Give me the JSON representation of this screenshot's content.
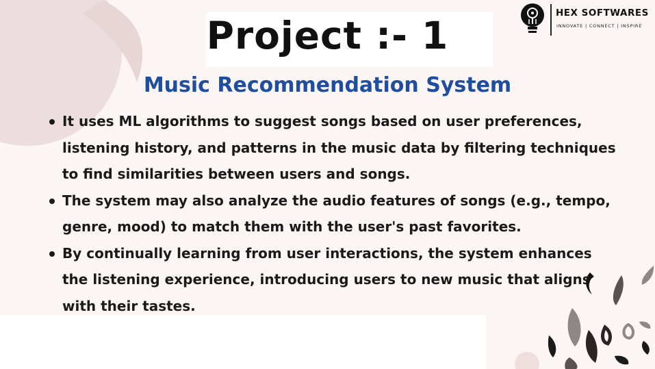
{
  "logo": {
    "name": "HEX SOFTWARES",
    "tagline": "INNOVATE | CONNECT | INSPIRE",
    "icon": "lightbulb-icon"
  },
  "slide": {
    "title": "Project :- 1",
    "subtitle": "Music Recommendation System",
    "bullets": [
      "It uses ML algorithms to suggest songs based on user preferences, listening history, and patterns in the music data by filtering techniques to find similarities between users and songs.",
      "The system may also analyze the audio features of songs (e.g., tempo, genre, mood) to match them with the user's past favorites.",
      "By continually learning from user interactions, the system enhances the listening experience, introducing users to new music that aligns with their tastes."
    ]
  },
  "colors": {
    "background": "#fbf6f3",
    "subtitle": "#1f4e9e",
    "text": "#1a1a1a",
    "blob": "#ecdcdc"
  }
}
